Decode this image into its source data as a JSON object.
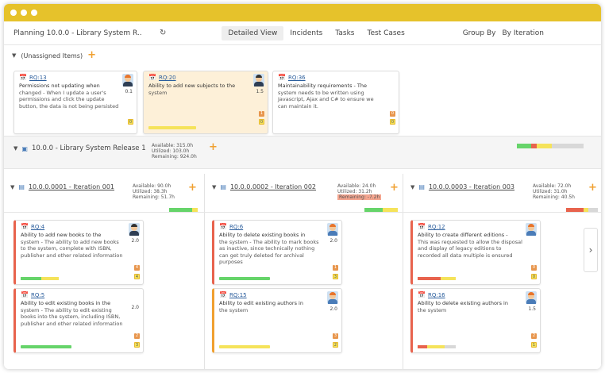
{
  "toolbar": {
    "title": "Planning  10.0.0 - Library System R..",
    "refresh_icon": "↻",
    "tabs": [
      "Detailed View",
      "Incidents",
      "Tasks",
      "Test Cases"
    ],
    "group_by_label": "Group By",
    "group_by_value": "By Iteration"
  },
  "unassigned": {
    "label": "(Unassigned Items)",
    "cards": [
      {
        "id": "RQ:13",
        "title": "Permissions not updating when",
        "desc": "changed - When I update a user's permissions and click the update button, the data is not being persisted",
        "est": "0.1",
        "badge": "0"
      },
      {
        "id": "RQ:20",
        "title": "Ability to add new subjects to the",
        "desc": "system",
        "est": "1.5",
        "badge1": "1",
        "badge2": "0"
      },
      {
        "id": "RQ:36",
        "title": "Maintainability requirements - The",
        "desc": "system needs to be written using Javascript, Ajax and C# to ensure we can maintain it.",
        "badge1": "0",
        "badge2": "0"
      }
    ]
  },
  "release": {
    "name": "10.0.0 - Library System Release 1",
    "available": "Available:  315.0h",
    "utilized": "Utilized:  103.0h",
    "remaining": "Remaining: 924.0h"
  },
  "iterations": [
    {
      "name": "10.0.0.0001 - Iteration 001",
      "available": "Available:  90.0h",
      "utilized": "Utilized:  38.3h",
      "remaining": "Remaining: 51.7h"
    },
    {
      "name": "10.0.0.0002 - Iteration 002",
      "available": "Available:  24.0h",
      "utilized": "Utilized:  31.2h",
      "remaining": "Remaining: -7.2h"
    },
    {
      "name": "10.0.0.0003 - Iteration 003",
      "available": "Available:  72.0h",
      "utilized": "Utilized:  31.0h",
      "remaining": "Remaining: 40.5h"
    }
  ],
  "iteration_cards": [
    {
      "id": "RQ:4",
      "title": "Ability to add new books to the",
      "desc": "system - The ability to add new books to the system, complete with ISBN, publisher and other related information",
      "est": "2.0",
      "badge1": "4",
      "badge2": "4"
    },
    {
      "id": "RQ:5",
      "title": "Ability to edit existing books in the",
      "desc": "system - The ability to edit existing books into the system, including ISBN, publisher and other related information",
      "est": "2.0",
      "badge1": "2",
      "badge2": "3"
    },
    {
      "id": "RQ:6",
      "title": "Ability to delete existing books in",
      "desc": "the system - The ability to mark books as inactive, since technically nothing can get truly deleted for archival purposes",
      "est": "2.0",
      "badge1": "1",
      "badge2": "3"
    },
    {
      "id": "RQ:15",
      "title": "Ability to edit existing authors in",
      "desc": "the system",
      "est": "2.0",
      "badge1": "3",
      "badge2": "2"
    },
    {
      "id": "RQ:12",
      "title": "Ability to create different editions -",
      "desc": "This was requested to allow the disposal and display of legacy editions to recorded all data multiple is ensured",
      "est": "2.0",
      "badge1": "0",
      "badge2": "0"
    },
    {
      "id": "RQ:16",
      "title": "Ability to delete existing authors in",
      "desc": "the system",
      "est": "1.5",
      "badge1": "2",
      "badge2": "1"
    }
  ],
  "colors": {
    "accent": "#e6c22b",
    "orange": "#f0a030",
    "red": "#e8634d",
    "green": "#66d46a",
    "yellow": "#f5e35a",
    "grey": "#d8d8d8"
  }
}
